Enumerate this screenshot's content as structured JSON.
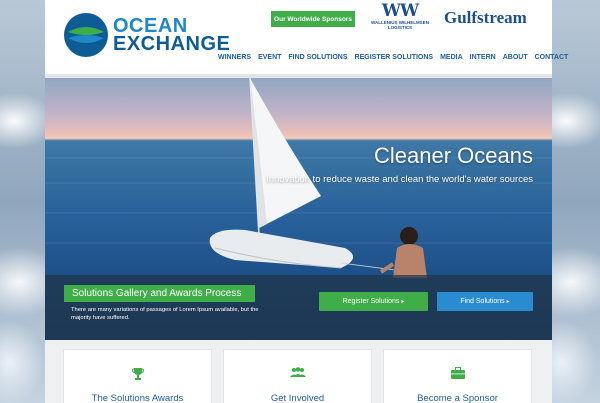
{
  "brand": {
    "line1": "OCEAN",
    "line2": "EXCHANGE"
  },
  "header": {
    "sponsor_button": "Our Worldwide Sponsors",
    "sponsor1_mark": "WW",
    "sponsor1_name": "WALLENIUS WILHELMSEN LOGISTICS",
    "sponsor2_name": "Gulfstream"
  },
  "nav": {
    "items": [
      "WINNERS",
      "EVENT",
      "FIND SOLUTIONS",
      "REGISTER SOLUTIONS",
      "MEDIA",
      "INTERN",
      "ABOUT",
      "CONTACT"
    ]
  },
  "hero": {
    "title": "Cleaner Oceans",
    "subtitle": "Innovation to reduce waste and clean the world's water sources"
  },
  "gallery": {
    "badge": "Solutions Gallery and Awards Process",
    "text": "There are many variations of passages of Lorem Ipsum available, but the majority have suffered.",
    "register_button": "Register Solutions",
    "find_button": "Find Solutions",
    "arrow": "▸"
  },
  "cards": [
    {
      "icon": "trophy-icon",
      "label": "The Solutions Awards"
    },
    {
      "icon": "people-icon",
      "label": "Get Involved"
    },
    {
      "icon": "briefcase-icon",
      "label": "Become a Sponsor"
    }
  ],
  "colors": {
    "green": "#3fae49",
    "blue": "#2a8cd0",
    "navy": "#1e5fa0"
  }
}
